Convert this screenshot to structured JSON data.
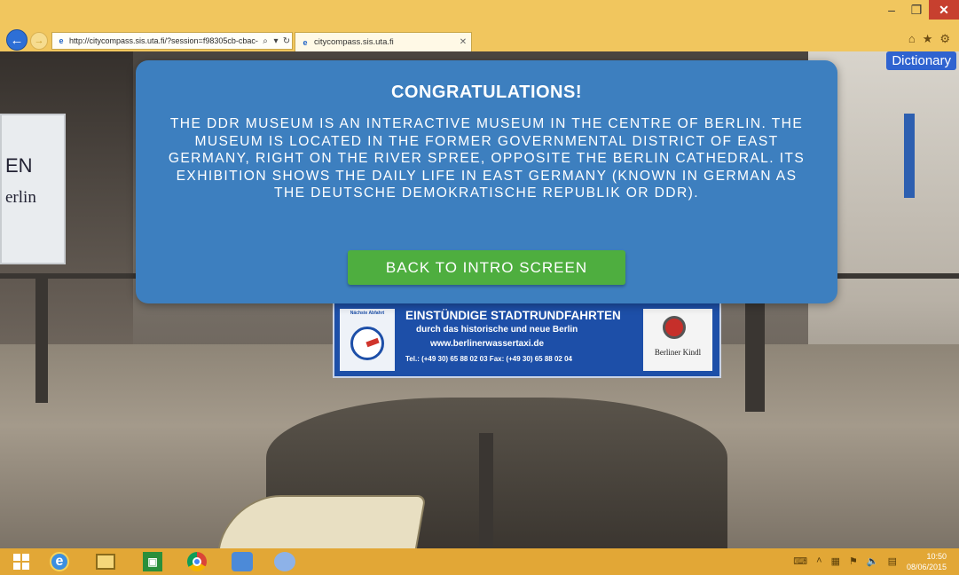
{
  "browser": {
    "window_title": "- ",
    "window_controls": {
      "minimize": "–",
      "maximize": "❐",
      "close": "✕"
    },
    "back_icon": "arrow-left-icon",
    "forward_icon": "arrow-right-icon",
    "address_url": "http://citycompass.sis.uta.fi/?session=f98305cb-cbac-",
    "address_search": "⌕",
    "address_dropdown": "▾",
    "address_refresh": "↻",
    "tab_label": "citycompass.sis.uta.fi",
    "tab_close": "✕",
    "tools": {
      "home": "⌂",
      "favorites": "★",
      "settings": "⚙"
    }
  },
  "page": {
    "dictionary_label": "Dictionary",
    "dialog": {
      "title": "CONGRATULATIONS!",
      "body": "THE DDR MUSEUM IS AN INTERACTIVE MUSEUM IN THE CENTRE OF BERLIN. THE MUSEUM IS LOCATED IN THE FORMER GOVERNMENTAL DISTRICT OF EAST GERMANY, RIGHT ON THE RIVER SPREE, OPPOSITE THE BERLIN CATHEDRAL. ITS EXHIBITION SHOWS THE DAILY LIFE IN EAST GERMANY (KNOWN IN GERMAN AS THE DEUTSCHE DEMOKRATISCHE REPUBLIK OR DDR).",
      "button_label": "BACK TO INTRO SCREEN"
    },
    "photo": {
      "sign_left_line1": "EN",
      "sign_left_line2": "erlin",
      "banner_line1": "EINSTÜNDIGE STADTRUNDFAHRTEN",
      "banner_line2": "durch das historische und neue Berlin",
      "banner_line3": "www.berlinerwassertaxi.de",
      "banner_line4": "Tel.: (+49 30) 65 88 02 03     Fax: (+49 30) 65 88 02 04",
      "clock_title": "Nächste Abfahrt",
      "logo_text": "Berliner Kindl"
    }
  },
  "taskbar": {
    "clock_time": "10:50",
    "clock_date": "08/06/2015",
    "tray_icons": [
      "keyboard-icon",
      "chevron-up-icon",
      "network-icon",
      "flag-icon",
      "volume-icon",
      "language-icon"
    ],
    "tray_glyphs": {
      "keyboard": "⌨",
      "chevron": "˄",
      "network": "▦",
      "flag": "⚑",
      "volume": "🔈",
      "lang": "▤"
    }
  }
}
